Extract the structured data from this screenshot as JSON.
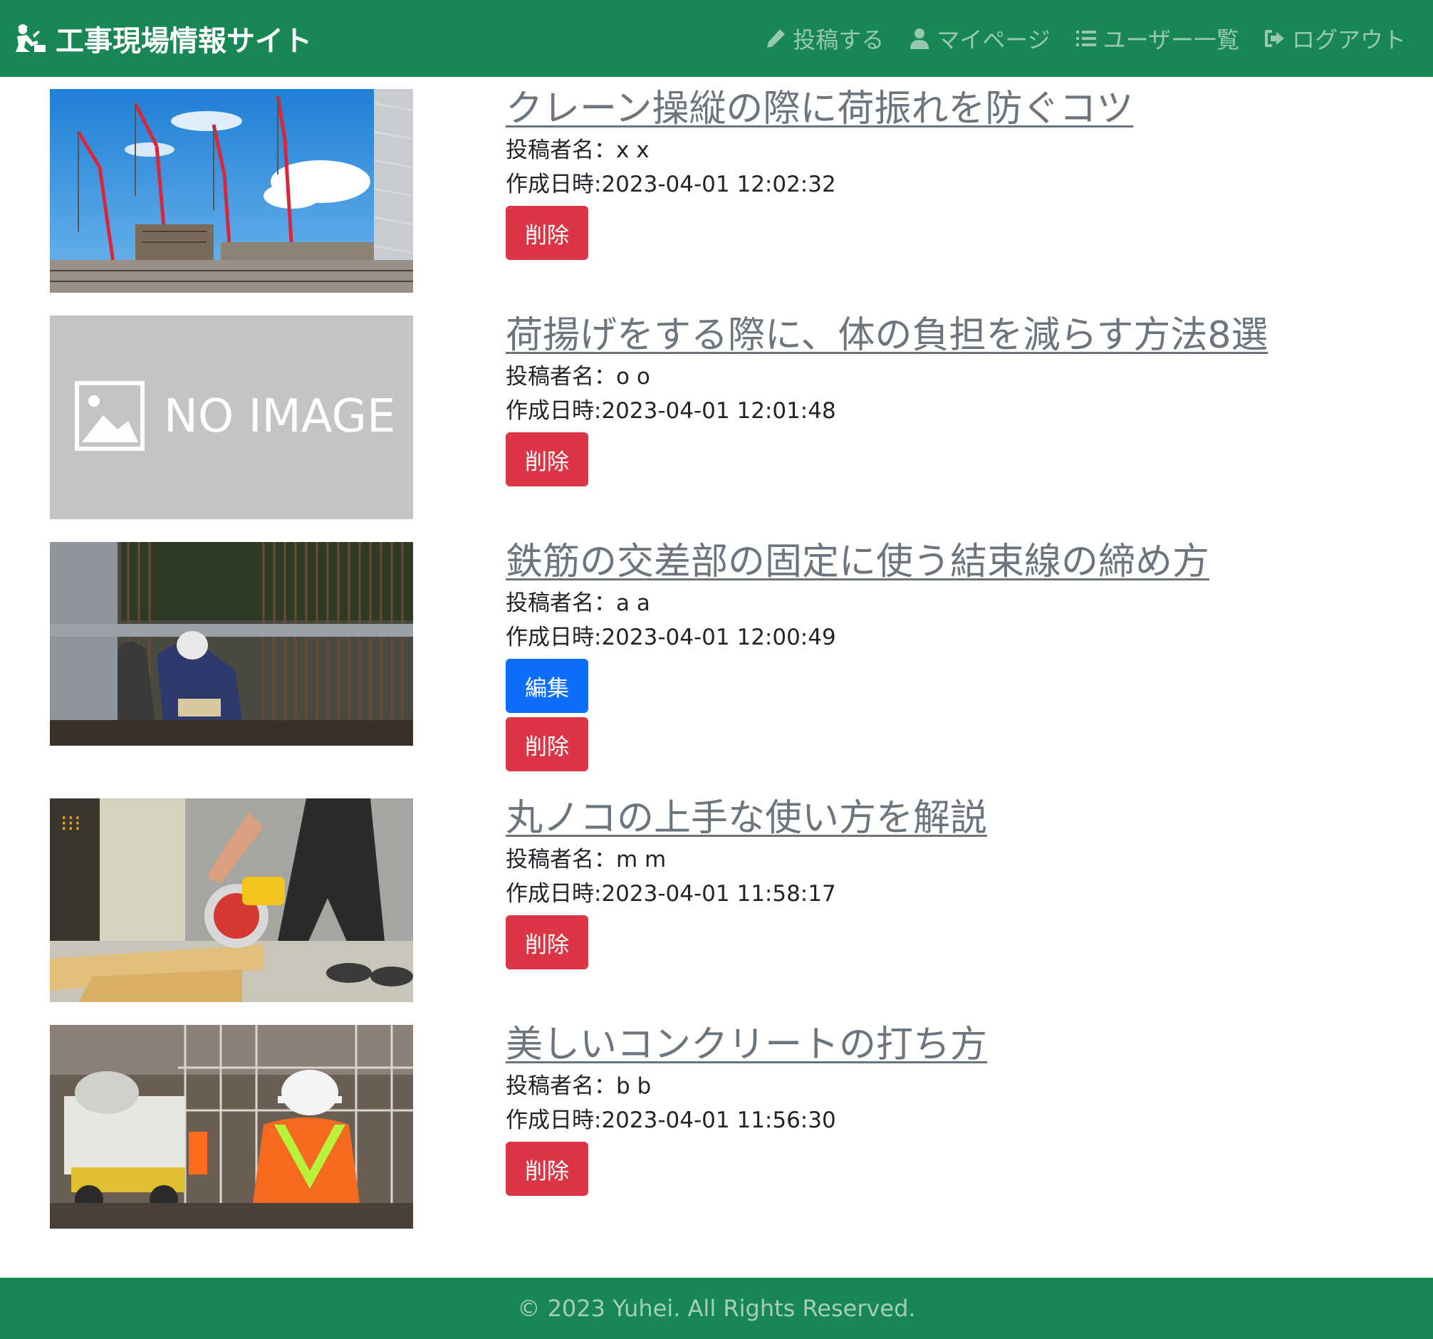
{
  "header": {
    "brand": "工事現場情報サイト",
    "nav": [
      {
        "label": "投稿する",
        "icon": "pencil-icon"
      },
      {
        "label": "マイページ",
        "icon": "user-icon"
      },
      {
        "label": "ユーザー一覧",
        "icon": "list-icon"
      },
      {
        "label": "ログアウト",
        "icon": "logout-icon"
      }
    ]
  },
  "posts": [
    {
      "title": "クレーン操縦の際に荷振れを防ぐコツ",
      "author_label": "投稿者名：",
      "author": "x x",
      "date_label": "作成日時:",
      "date": "2023-04-01 12:02:32",
      "delete_label": "削除",
      "image": "crane-photo"
    },
    {
      "title": "荷揚げをする際に、体の負担を減らす方法8選",
      "author_label": "投稿者名：",
      "author": "o o",
      "date_label": "作成日時:",
      "date": "2023-04-01 12:01:48",
      "delete_label": "削除",
      "image": "no-image",
      "no_image_text": "NO IMAGE"
    },
    {
      "title": "鉄筋の交差部の固定に使う結束線の締め方",
      "author_label": "投稿者名：",
      "author": "a a",
      "date_label": "作成日時:",
      "date": "2023-04-01 12:00:49",
      "edit_label": "編集",
      "delete_label": "削除",
      "image": "rebar-photo"
    },
    {
      "title": "丸ノコの上手な使い方を解説",
      "author_label": "投稿者名：",
      "author": "m m",
      "date_label": "作成日時:",
      "date": "2023-04-01 11:58:17",
      "delete_label": "削除",
      "image": "circular-saw-photo"
    },
    {
      "title": "美しいコンクリートの打ち方",
      "author_label": "投稿者名：",
      "author": "b b",
      "date_label": "作成日時:",
      "date": "2023-04-01 11:56:30",
      "delete_label": "削除",
      "image": "concrete-worker-photo"
    }
  ],
  "footer": {
    "text": "© 2023 Yuhei. All Rights Reserved."
  },
  "colors": {
    "navbar": "#198754",
    "danger": "#dc3545",
    "primary": "#0d6efd",
    "link": "#6c757d"
  }
}
